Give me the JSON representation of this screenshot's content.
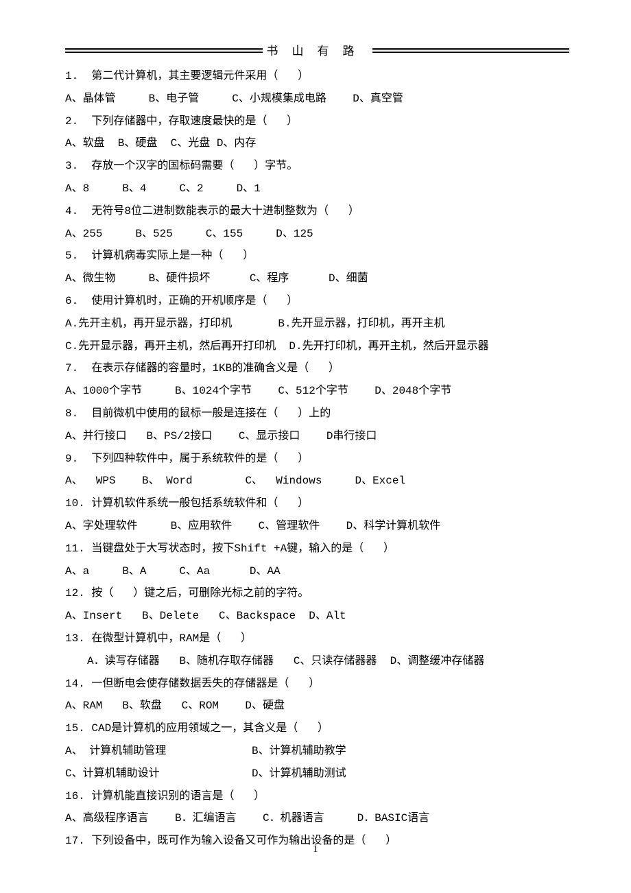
{
  "header": {
    "title": "书山有路"
  },
  "lines": [
    {
      "text": "1.  第二代计算机，其主要逻辑元件采用（   ）",
      "indent": false
    },
    {
      "text": "A、晶体管     B、电子管     C、小规模集成电路    D、真空管",
      "indent": false
    },
    {
      "text": "2.  下列存储器中，存取速度最快的是（   ）",
      "indent": false
    },
    {
      "text": "A、软盘  B、硬盘  C、光盘 D、内存",
      "indent": false
    },
    {
      "text": "3.  存放一个汉字的国标码需要（   ）字节。",
      "indent": false
    },
    {
      "text": "A、8     B、4     C、2     D、1",
      "indent": false
    },
    {
      "text": "4.  无符号8位二进制数能表示的最大十进制整数为（   ）",
      "indent": false
    },
    {
      "text": "A、255     B、525     C、155     D、125",
      "indent": false
    },
    {
      "text": "5.  计算机病毒实际上是一种（   ）",
      "indent": false
    },
    {
      "text": "A、微生物     B、硬件损坏      C、程序      D、细菌",
      "indent": false
    },
    {
      "text": "6.  使用计算机时，正确的开机顺序是（   ）",
      "indent": false
    },
    {
      "text": "A.先开主机，再开显示器，打印机       B.先开显示器，打印机，再开主机",
      "indent": false
    },
    {
      "text": "C.先开显示器，再开主机，然后再开打印机  D.先开打印机，再开主机，然后开显示器",
      "indent": false
    },
    {
      "text": "7.  在表示存储器的容量时，1KB的准确含义是（   ）",
      "indent": false
    },
    {
      "text": "A、1000个字节     B、1024个字节    C、512个字节    D、2048个字节",
      "indent": false
    },
    {
      "text": "8.  目前微机中使用的鼠标一般是连接在（   ）上的",
      "indent": false
    },
    {
      "text": "A、并行接口   B、PS/2接口    C、显示接口    D串行接口",
      "indent": false
    },
    {
      "text": "9.  下列四种软件中，属于系统软件的是（   ）",
      "indent": false
    },
    {
      "text": "A、  WPS    B、 Word        C、  Windows     D、Excel",
      "indent": false
    },
    {
      "text": "10. 计算机软件系统一般包括系统软件和（   ）",
      "indent": false
    },
    {
      "text": "A、字处理软件     B、应用软件    C、管理软件    D、科学计算机软件",
      "indent": false
    },
    {
      "text": "11. 当键盘处于大写状态时，按下Shift +A键，输入的是（   ）",
      "indent": false
    },
    {
      "text": "A、a     B、A     C、Aa      D、AA",
      "indent": false
    },
    {
      "text": "12. 按（   ）键之后，可删除光标之前的字符。",
      "indent": false
    },
    {
      "text": "A、Insert   B、Delete   C、Backspace  D、Alt",
      "indent": false
    },
    {
      "text": "13. 在微型计算机中，RAM是（   ）",
      "indent": false
    },
    {
      "text": "A．读写存储器   B、随机存取存储器   C、只读存储器器  D、调整缓冲存储器",
      "indent": true
    },
    {
      "text": "14. 一但断电会使存储数据丢失的存储器是（   ）",
      "indent": false
    },
    {
      "text": "A、RAM   B、软盘   C、ROM    D、硬盘",
      "indent": false
    },
    {
      "text": "15. CAD是计算机的应用领域之一，其含义是（   ）",
      "indent": false
    },
    {
      "text": "A、 计算机辅助管理             B、计算机辅助教学",
      "indent": false
    },
    {
      "text": "C、计算机辅助设计              D、计算机辅助测试",
      "indent": false
    },
    {
      "text": "16. 计算机能直接识别的语言是（   ）",
      "indent": false
    },
    {
      "text": "A、高级程序语言    B．汇编语言    C．机器语言     D．BASIC语言",
      "indent": false
    },
    {
      "text": "17. 下列设备中，既可作为输入设备又可作为输出设备的是（   ）",
      "indent": false
    }
  ],
  "pageNumber": "1"
}
